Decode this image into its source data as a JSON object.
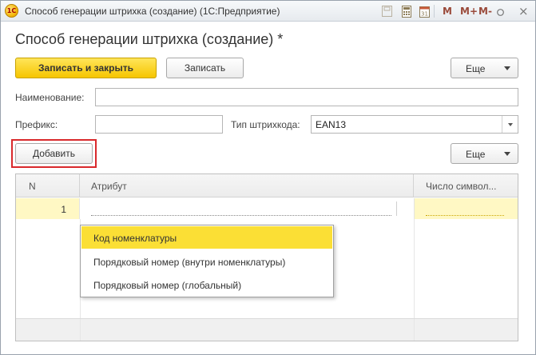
{
  "window": {
    "title": "Способ генерации штрихка (создание)  (1С:Предприятие)",
    "app_logo_text": "1С",
    "toolbar": {
      "m": "M",
      "m_plus": "M+",
      "m_minus": "M-",
      "close": "×"
    }
  },
  "form": {
    "page_title": "Способ генерации штрихка (создание) *",
    "buttons": {
      "save_and_close": "Записать и закрыть",
      "save": "Записать",
      "more_top": "Еще",
      "add": "Добавить",
      "more_table": "Еще"
    },
    "fields": {
      "name_label": "Наименование:",
      "name_value": "",
      "prefix_label": "Префикс:",
      "prefix_value": "",
      "barcode_type_label": "Тип штрихкода:",
      "barcode_type_value": "EAN13"
    },
    "table": {
      "columns": [
        "N",
        "Атрибут",
        "Число символ..."
      ],
      "rows": [
        {
          "n": "1",
          "attribute": "",
          "chars": ""
        }
      ]
    },
    "dropdown": {
      "items": [
        {
          "label": "Код номенклатуры",
          "selected": true
        },
        {
          "label": "Порядковый номер (внутри номенклатуры)",
          "selected": false
        },
        {
          "label": "Порядковый номер (глобальный)",
          "selected": false
        }
      ]
    }
  },
  "colors": {
    "primary_button": "#f6c500",
    "highlight_box": "#d9292c",
    "selected_item": "#fbdf35",
    "row_highlight": "#fff8c4"
  }
}
